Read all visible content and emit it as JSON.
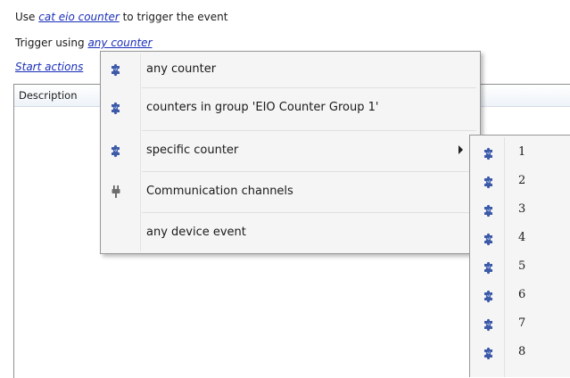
{
  "header": {
    "line1_prefix": "Use",
    "line1_link": "cat eio counter",
    "line1_suffix": "to trigger the event",
    "line2_prefix": "Trigger using",
    "line2_link": "any counter",
    "line3_link": "Start actions"
  },
  "list": {
    "column_description": "Description"
  },
  "context_menu": {
    "items": [
      {
        "label": "any counter",
        "icon": "puzzle-icon"
      },
      {
        "label": "counters in group 'EIO Counter Group 1'",
        "icon": "puzzle-icon"
      },
      {
        "label": "specific counter",
        "icon": "puzzle-icon",
        "has_submenu": true
      },
      {
        "label": "Communication channels",
        "icon": "plug-icon"
      },
      {
        "label": "any device event",
        "icon": ""
      }
    ]
  },
  "submenu": {
    "items": [
      "1",
      "2",
      "3",
      "4",
      "5",
      "6",
      "7",
      "8"
    ]
  },
  "colors": {
    "link": "#1a2fb8",
    "menu_bg": "#f5f5f5",
    "icon_blue": "#3d5aa8"
  }
}
